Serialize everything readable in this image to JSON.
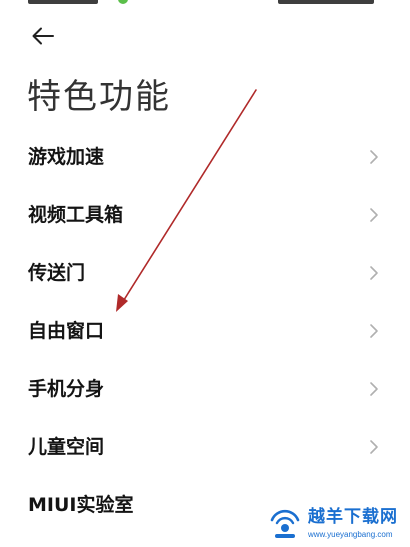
{
  "page": {
    "title": "特色功能"
  },
  "feature_list": {
    "items": [
      {
        "label": "游戏加速"
      },
      {
        "label": "视频工具箱"
      },
      {
        "label": "传送门"
      },
      {
        "label": "自由窗口"
      },
      {
        "label": "手机分身"
      },
      {
        "label": "儿童空间"
      },
      {
        "label": "MIUI实验室"
      }
    ]
  },
  "watermark": {
    "name": "越羊下载网",
    "url": "www.yueyangbang.com"
  },
  "colors": {
    "annotation_arrow": "#b02a2a",
    "watermark": "#1a6fd0",
    "chevron": "#b0b0b0"
  },
  "icons": {
    "back": "arrow-left-icon",
    "chevron": "chevron-right-icon"
  }
}
